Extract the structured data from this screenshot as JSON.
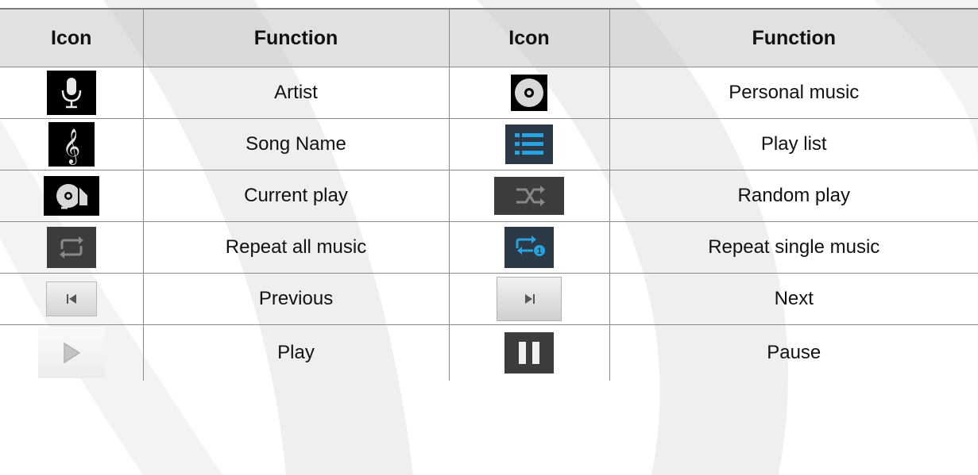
{
  "table": {
    "headers": [
      "Icon",
      "Function",
      "Icon",
      "Function"
    ],
    "rows": [
      {
        "left_icon": "microphone-icon",
        "left_label": "Artist",
        "right_icon": "cd-disc-icon",
        "right_label": "Personal music"
      },
      {
        "left_icon": "treble-clef-icon",
        "left_label": "Song Name",
        "right_icon": "playlist-icon",
        "right_label": "Play list"
      },
      {
        "left_icon": "current-play-icon",
        "left_label": "Current play",
        "right_icon": "shuffle-icon",
        "right_label": "Random play"
      },
      {
        "left_icon": "repeat-all-icon",
        "left_label": "Repeat all music",
        "right_icon": "repeat-single-icon",
        "right_label": "Repeat single music"
      },
      {
        "left_icon": "previous-icon",
        "left_label": "Previous",
        "right_icon": "next-icon",
        "right_label": "Next"
      },
      {
        "left_icon": "play-icon",
        "left_label": "Play",
        "right_icon": "pause-icon",
        "right_label": "Pause"
      }
    ]
  },
  "colors": {
    "header_bg": "#c8c8c8",
    "accent_blue": "#29a3e0",
    "icon_dark_bg": "#000000",
    "icon_gray_bg": "#3c3c3c"
  }
}
